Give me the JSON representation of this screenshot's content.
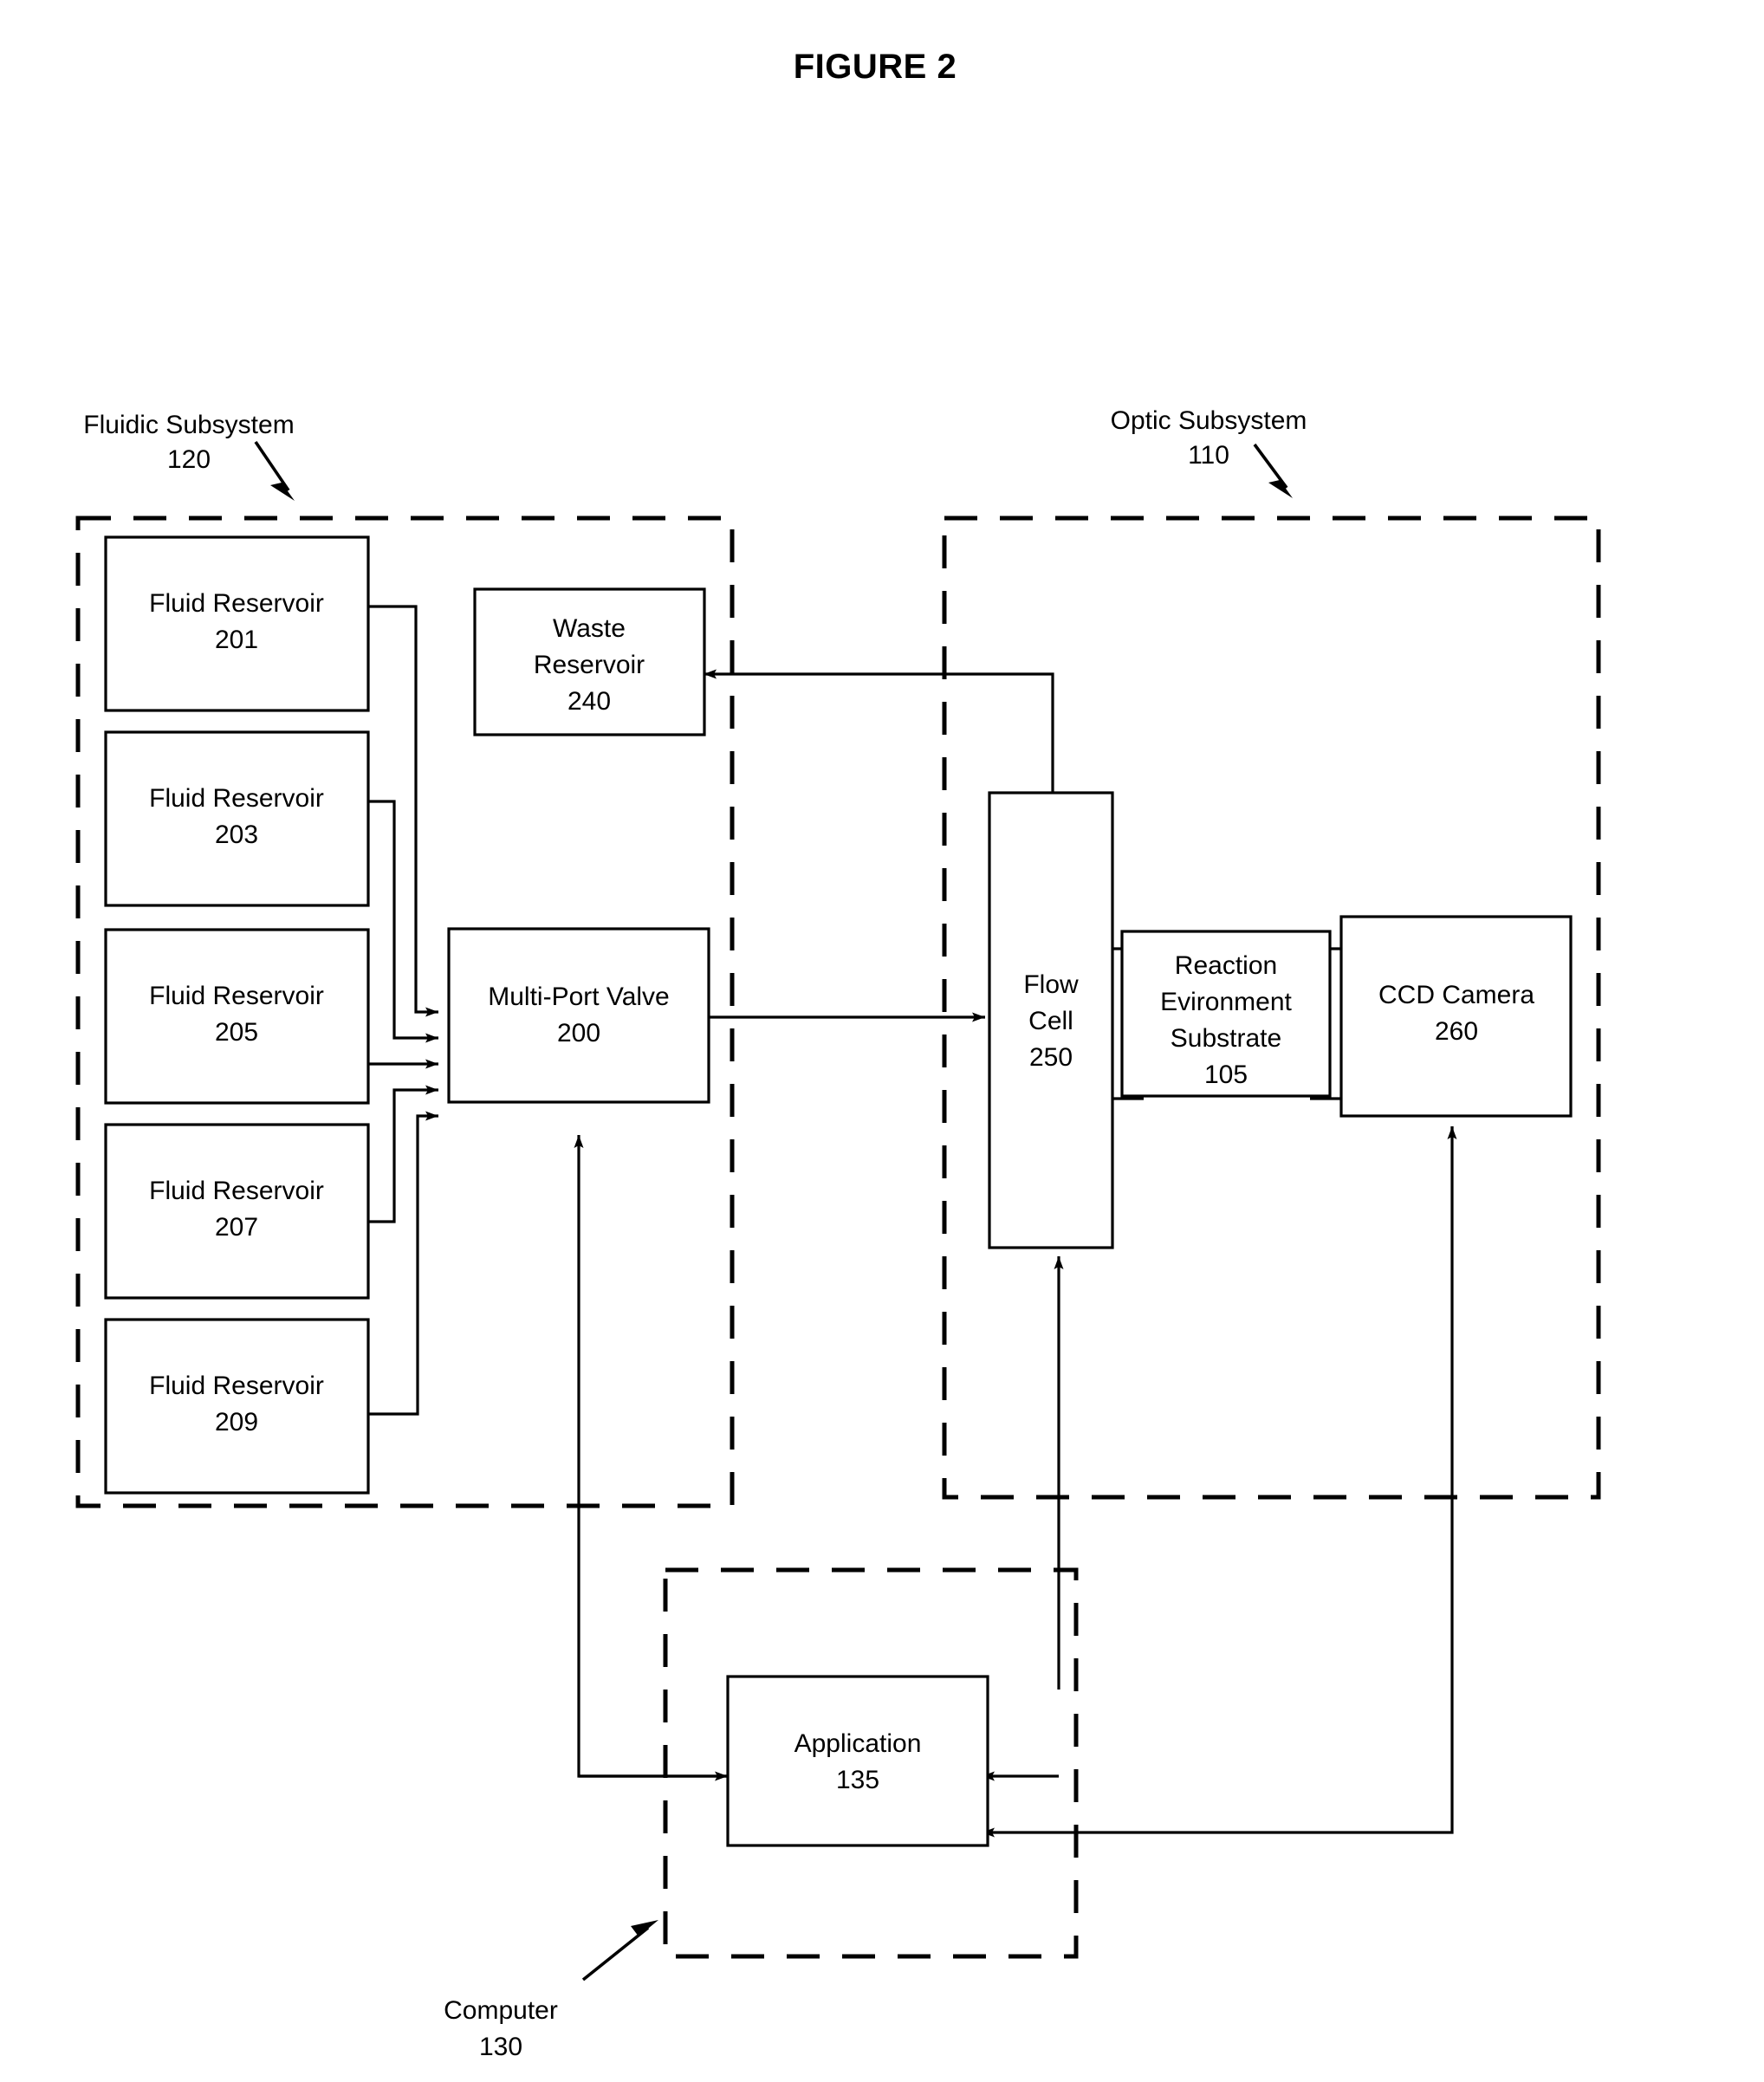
{
  "figure": {
    "title": "FIGURE 2"
  },
  "subsystems": [
    {
      "id": "fluidic",
      "name": "Fluidic Subsystem",
      "ref": "120",
      "label_line1": "Fluidic Subsystem",
      "label_line2": "120"
    },
    {
      "id": "optic",
      "name": "Optic Subsystem",
      "ref": "110",
      "label_line1": "Optic Subsystem",
      "label_line2": "110"
    },
    {
      "id": "computer",
      "name": "Computer",
      "ref": "130",
      "label_line1": "Computer",
      "label_line2": "130"
    }
  ],
  "blocks": {
    "reservoir_201": {
      "line1": "Fluid Reservoir",
      "line2": "201"
    },
    "reservoir_203": {
      "line1": "Fluid Reservoir",
      "line2": "203"
    },
    "reservoir_205": {
      "line1": "Fluid Reservoir",
      "line2": "205"
    },
    "reservoir_207": {
      "line1": "Fluid Reservoir",
      "line2": "207"
    },
    "reservoir_209": {
      "line1": "Fluid Reservoir",
      "line2": "209"
    },
    "waste_reservoir": {
      "line1": "Waste",
      "line2": "Reservoir",
      "line3": "240"
    },
    "multi_port_valve": {
      "line1": "Multi-Port Valve",
      "line2": "200"
    },
    "flow_cell": {
      "line1": "Flow",
      "line2": "Cell",
      "line3": "250"
    },
    "reaction_substrate": {
      "line1": "Reaction",
      "line2": "Evironment",
      "line3": "Substrate",
      "line4": "105"
    },
    "ccd_camera": {
      "line1": "CCD Camera",
      "line2": "260"
    },
    "application": {
      "line1": "Application",
      "line2": "135"
    }
  },
  "colors": {
    "stroke": "#000000",
    "fill": "#ffffff",
    "background": "#ffffff"
  }
}
